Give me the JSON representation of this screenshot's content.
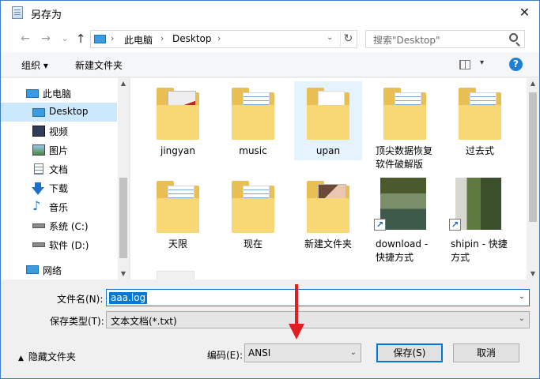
{
  "window": {
    "title": "另存为",
    "close_symbol": "✕"
  },
  "navigation": {
    "back": "←",
    "forward": "→",
    "recent": "⌄",
    "up": "↑",
    "address": [
      "此电脑",
      "Desktop"
    ],
    "separator": "›",
    "refresh": "↻",
    "dropdown": "⌄",
    "search_placeholder": "搜索\"Desktop\""
  },
  "toolbar": {
    "organize": "组织 ▾",
    "new_folder": "新建文件夹",
    "view_arrow": "▾",
    "help": "?"
  },
  "sidebar": {
    "items": [
      {
        "label": "此电脑",
        "icon": "computer-icon",
        "selected": false
      },
      {
        "label": "Desktop",
        "icon": "desktop-icon",
        "selected": true
      },
      {
        "label": "视频",
        "icon": "video-icon",
        "selected": false
      },
      {
        "label": "图片",
        "icon": "pictures-icon",
        "selected": false
      },
      {
        "label": "文档",
        "icon": "documents-icon",
        "selected": false
      },
      {
        "label": "下载",
        "icon": "download-icon",
        "selected": false
      },
      {
        "label": "音乐",
        "icon": "music-icon",
        "selected": false
      },
      {
        "label": "系统 (C:)",
        "icon": "drive-c-icon",
        "selected": false
      },
      {
        "label": "软件 (D:)",
        "icon": "drive-d-icon",
        "selected": false
      },
      {
        "label": "网络",
        "icon": "network-icon",
        "selected": false
      }
    ]
  },
  "files": [
    {
      "name": "jingyan",
      "kind": "folder-photo"
    },
    {
      "name": "music",
      "kind": "folder-doc"
    },
    {
      "name": "upan",
      "kind": "folder-empty"
    },
    {
      "name": "顶尖数据恢复软件破解版",
      "kind": "folder-doc"
    },
    {
      "name": "过去式",
      "kind": "folder-doc"
    },
    {
      "name": "天限",
      "kind": "folder-doc"
    },
    {
      "name": "现在",
      "kind": "folder-doc"
    },
    {
      "name": "新建文件夹",
      "kind": "folder-photo"
    },
    {
      "name": "download - 快捷方式",
      "kind": "shortcut"
    },
    {
      "name": "shipin - 快捷方式",
      "kind": "shortcut"
    }
  ],
  "form": {
    "filename_label": "文件名(N):",
    "filename_value": "aaa.log",
    "filetype_label": "保存类型(T):",
    "filetype_value": "文本文档(*.txt)",
    "hide_folders": "隐藏文件夹",
    "hide_caret": "▲",
    "encoding_label": "编码(E):",
    "encoding_value": "ANSI",
    "save_button": "保存(S)",
    "cancel_button": "取消",
    "dropdown_arrow": "⌄"
  },
  "colors": {
    "accent": "#0078d7",
    "selection": "#cce8ff",
    "folder": "#f8d775",
    "annotation": "#e02020"
  }
}
